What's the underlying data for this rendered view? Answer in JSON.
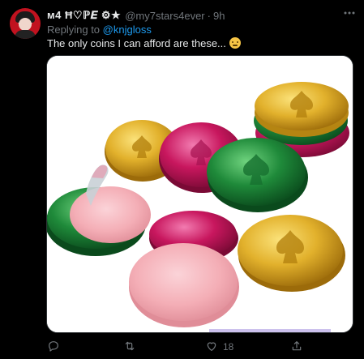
{
  "tweet": {
    "display_name": "ᴍ4 Ħ♡ℙ𝑬 ⚙★",
    "handle": "@my7stars4ever",
    "separator": "·",
    "time": "9h",
    "reply_prefix": "Replying to",
    "reply_to": "@knjgloss",
    "text": "The only coins I can afford are these...",
    "emoji": "slightly-smiling-face-icon",
    "more_icon": "more-horizontal-icon"
  },
  "media": {
    "description_icon": "image",
    "subject": "chocolate-coins-photo"
  },
  "actions": {
    "reply": {
      "icon": "reply-icon",
      "count": ""
    },
    "retweet": {
      "icon": "retweet-icon",
      "count": ""
    },
    "like": {
      "icon": "heart-icon",
      "count": "18"
    },
    "share": {
      "icon": "share-icon",
      "count": ""
    }
  },
  "colors": {
    "background": "#000000",
    "text_primary": "#e7e9ea",
    "text_secondary": "#71767b",
    "link": "#1d9bf0",
    "coin_gold": "#e2b12c",
    "coin_green": "#1f8a3a",
    "coin_magenta": "#c8175e",
    "candy_pink": "#f4aeb6"
  }
}
